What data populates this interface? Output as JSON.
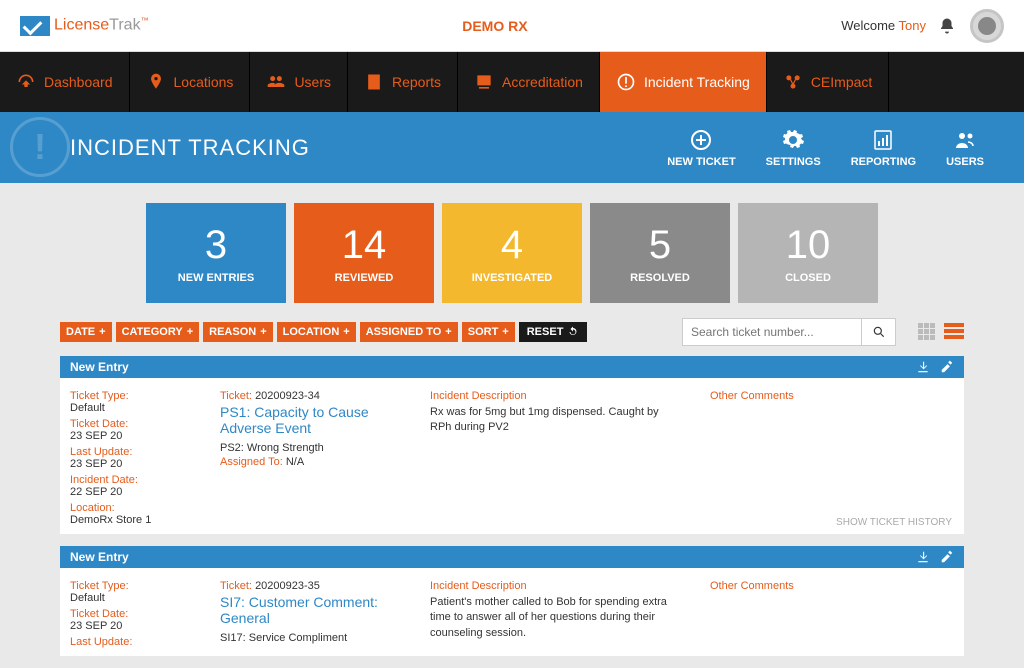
{
  "header": {
    "logo_text_1": "License",
    "logo_text_2": "Trak",
    "center_title": "DEMO RX",
    "welcome_prefix": "Welcome ",
    "welcome_user": "Tony"
  },
  "nav": {
    "items": [
      {
        "label": "Dashboard"
      },
      {
        "label": "Locations"
      },
      {
        "label": "Users"
      },
      {
        "label": "Reports"
      },
      {
        "label": "Accreditation"
      },
      {
        "label": "Incident Tracking"
      },
      {
        "label": "CEImpact"
      }
    ]
  },
  "subheader": {
    "title": "INCIDENT TRACKING",
    "actions": [
      {
        "label": "NEW TICKET"
      },
      {
        "label": "SETTINGS"
      },
      {
        "label": "REPORTING"
      },
      {
        "label": "USERS"
      }
    ]
  },
  "stats": [
    {
      "count": "3",
      "label": "NEW ENTRIES",
      "cls": "card-blue"
    },
    {
      "count": "14",
      "label": "REVIEWED",
      "cls": "card-orange"
    },
    {
      "count": "4",
      "label": "INVESTIGATED",
      "cls": "card-yellow"
    },
    {
      "count": "5",
      "label": "RESOLVED",
      "cls": "card-grey"
    },
    {
      "count": "10",
      "label": "CLOSED",
      "cls": "card-lightgrey"
    }
  ],
  "filters": {
    "chips": [
      "DATE",
      "CATEGORY",
      "REASON",
      "LOCATION",
      "ASSIGNED TO",
      "SORT"
    ],
    "reset": "RESET",
    "search_placeholder": "Search ticket number..."
  },
  "section_label": "New Entry",
  "tickets": [
    {
      "left": {
        "type_label": "Ticket Type:",
        "type_val": "Default",
        "date_label": "Ticket Date:",
        "date_val": "23 SEP 20",
        "update_label": "Last Update:",
        "update_val": "23 SEP 20",
        "incident_label": "Incident Date:",
        "incident_val": "22 SEP 20",
        "location_label": "Location:",
        "location_val": "DemoRx Store 1"
      },
      "mid": {
        "ticket_label": "Ticket:",
        "ticket_num": "20200923-34",
        "title": "PS1: Capacity to Cause Adverse Event",
        "subtitle": "PS2: Wrong Strength",
        "assigned_label": "Assigned To:",
        "assigned_val": "N/A"
      },
      "desc": {
        "label": "Incident Description",
        "text": "Rx was for 5mg but 1mg dispensed. Caught by RPh during PV2"
      },
      "comments_label": "Other Comments",
      "history": "SHOW TICKET HISTORY"
    },
    {
      "left": {
        "type_label": "Ticket Type:",
        "type_val": "Default",
        "date_label": "Ticket Date:",
        "date_val": "23 SEP 20",
        "update_label": "Last Update:"
      },
      "mid": {
        "ticket_label": "Ticket:",
        "ticket_num": "20200923-35",
        "title": "SI7: Customer Comment: General",
        "subtitle": "SI17: Service Compliment"
      },
      "desc": {
        "label": "Incident Description",
        "text": "Patient's mother called to Bob for spending extra time to answer all of her questions during their counseling session."
      },
      "comments_label": "Other Comments"
    }
  ]
}
